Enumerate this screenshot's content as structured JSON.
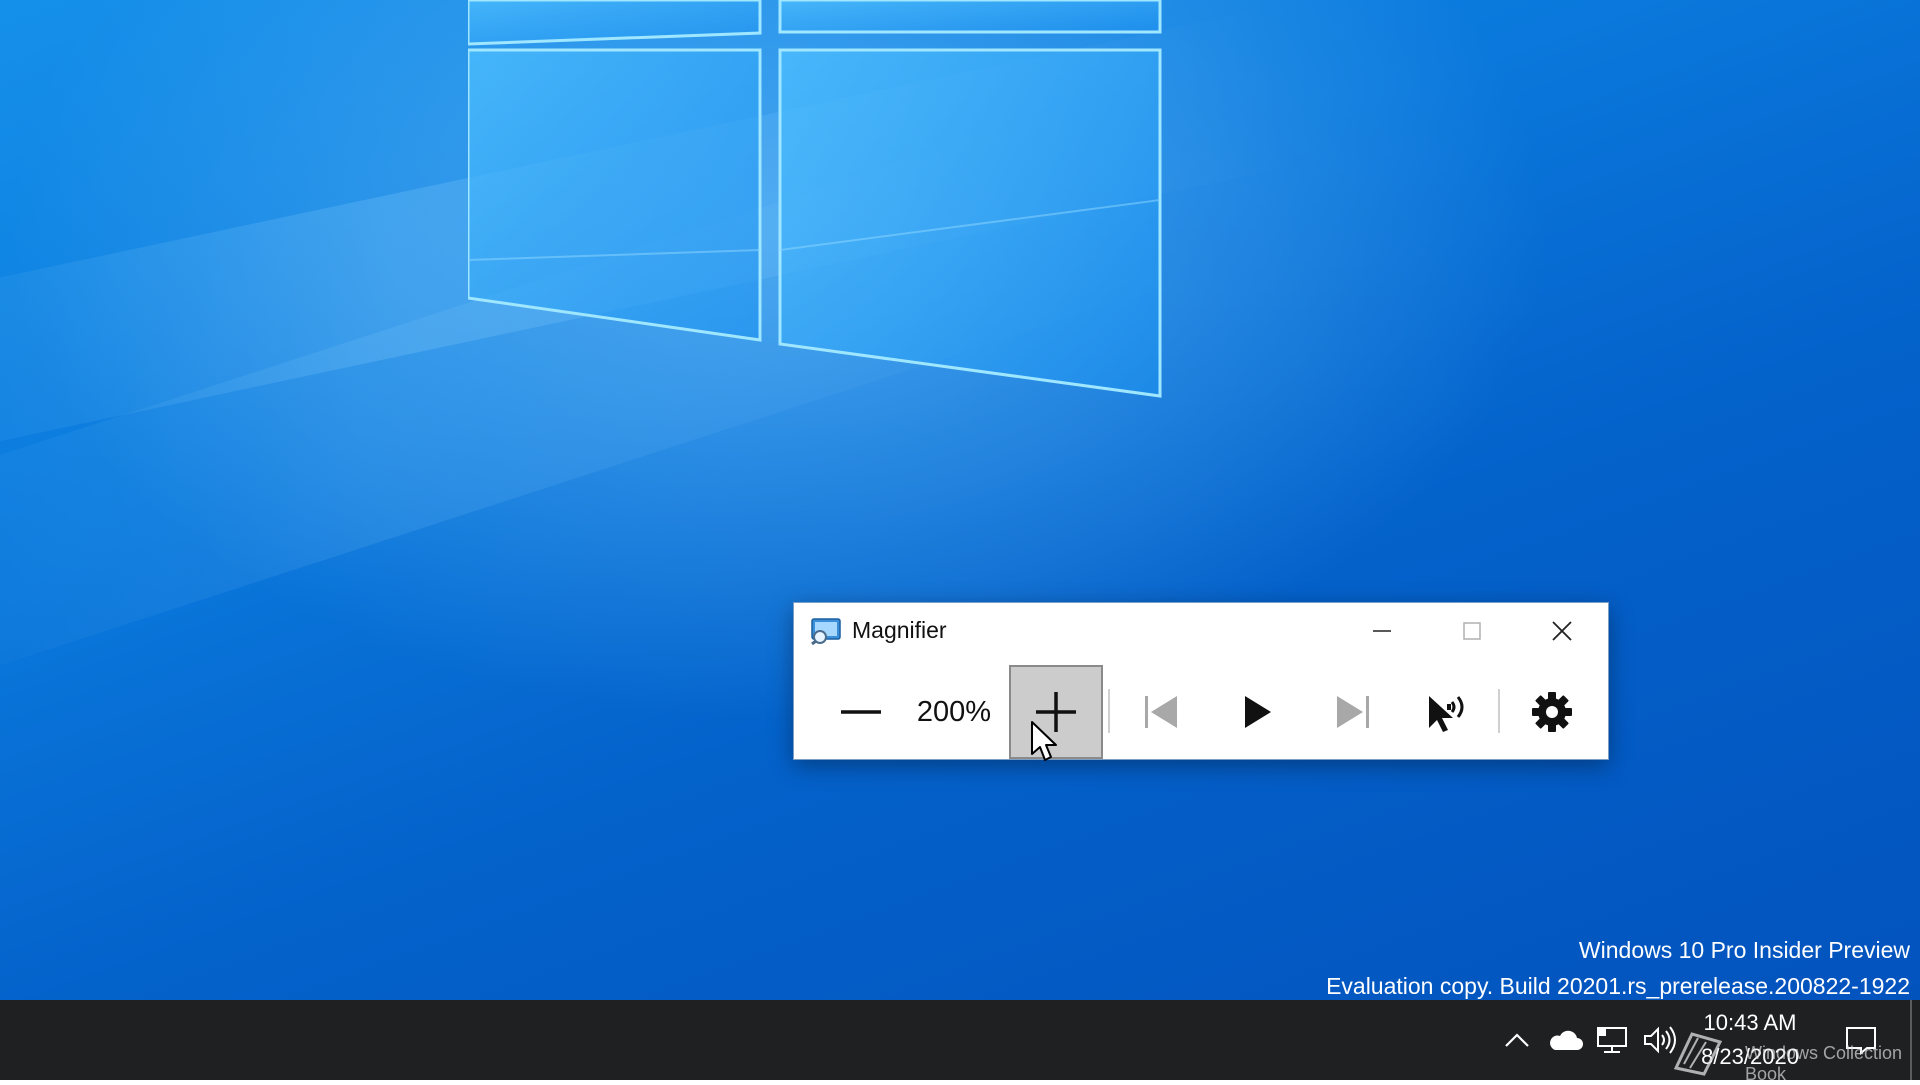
{
  "magnifier": {
    "title": "Magnifier",
    "zoom_level": "200%",
    "buttons": {
      "zoom_out": "Zoom out",
      "zoom_in": "Zoom in",
      "previous": "Previous sentence",
      "play": "Read",
      "next": "Next sentence",
      "read_from_here": "Read from here",
      "settings": "Settings"
    }
  },
  "desktop": {
    "watermark_line1": "Windows 10 Pro Insider Preview",
    "watermark_line2": "Evaluation copy. Build 20201.rs_prerelease.200822-1922"
  },
  "taskbar": {
    "time": "10:43 AM",
    "date": "8/23/2020",
    "overlay_text": "Windows Collection Book",
    "tray_icons": [
      "chevron-up-icon",
      "onedrive-cloud-icon",
      "network-icon",
      "volume-icon",
      "notification-icon"
    ]
  },
  "colors": {
    "desktop_blue": "#0a78dc",
    "taskbar": "#1f2022",
    "zoom_in_pressed": "#cccccc"
  }
}
